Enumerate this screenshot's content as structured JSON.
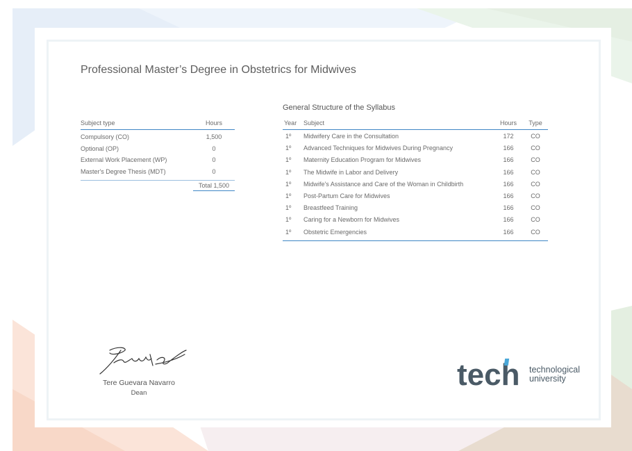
{
  "certificate": {
    "title": "Professional Master’s Degree in Obstetrics for Midwives"
  },
  "subject_table": {
    "headers": {
      "type": "Subject type",
      "hours": "Hours"
    },
    "rows": [
      {
        "type": "Compulsory (CO)",
        "hours": "1,500"
      },
      {
        "type": "Optional (OP)",
        "hours": "0"
      },
      {
        "type": "External Work Placement (WP)",
        "hours": "0"
      },
      {
        "type": "Master's Degree Thesis (MDT)",
        "hours": "0"
      }
    ],
    "total": "Total 1,500"
  },
  "syllabus": {
    "title": "General Structure of the Syllabus",
    "headers": {
      "year": "Year",
      "subject": "Subject",
      "hours": "Hours",
      "type": "Type"
    },
    "rows": [
      {
        "year": "1º",
        "subject": "Midwifery Care in the Consultation",
        "hours": "172",
        "type": "CO"
      },
      {
        "year": "1º",
        "subject": "Advanced Techniques for Midwives During Pregnancy",
        "hours": "166",
        "type": "CO"
      },
      {
        "year": "1º",
        "subject": "Maternity Education Program for Midwives",
        "hours": "166",
        "type": "CO"
      },
      {
        "year": "1º",
        "subject": "The Midwife in Labor and Delivery",
        "hours": "166",
        "type": "CO"
      },
      {
        "year": "1º",
        "subject": "Midwife's Assistance and Care of the Woman in Childbirth",
        "hours": "166",
        "type": "CO"
      },
      {
        "year": "1º",
        "subject": "Post-Partum Care for Midwives",
        "hours": "166",
        "type": "CO"
      },
      {
        "year": "1º",
        "subject": "Breastfeed Training",
        "hours": "166",
        "type": "CO"
      },
      {
        "year": "1º",
        "subject": "Caring for a Newborn for Midwives",
        "hours": "166",
        "type": "CO"
      },
      {
        "year": "1º",
        "subject": "Obstetric Emergencies",
        "hours": "166",
        "type": "CO"
      }
    ]
  },
  "signatory": {
    "name": "Tere Guevara Navarro",
    "role": "Dean"
  },
  "logo": {
    "brand": "tech",
    "line1": "technological",
    "line2": "university",
    "accent_color": "#4aa7d8",
    "text_color": "#4a5a66"
  }
}
